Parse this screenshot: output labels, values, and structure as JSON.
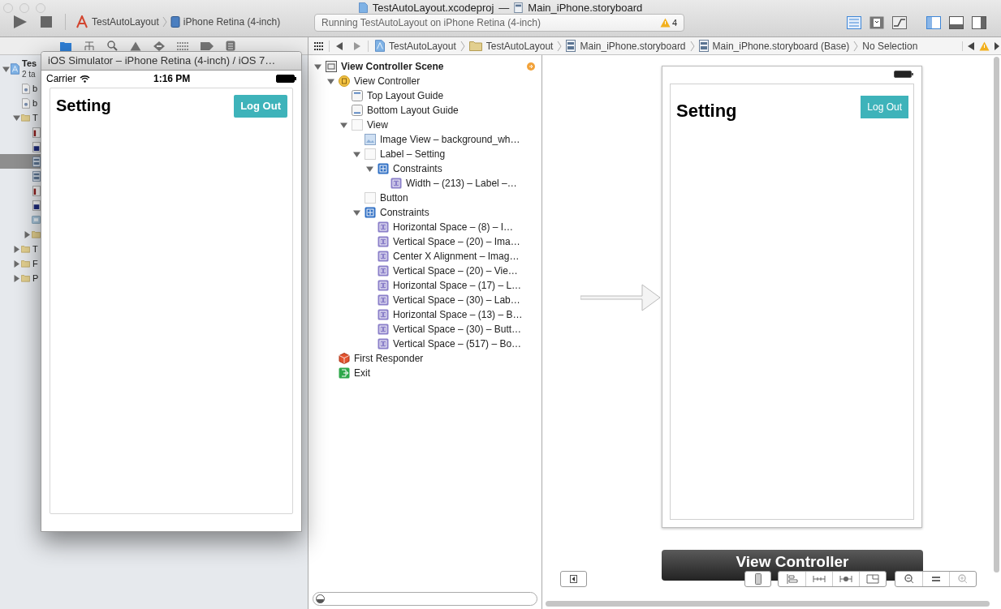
{
  "window": {
    "file": "TestAutoLayout.xcodeproj",
    "separator": "—",
    "document": "Main_iPhone.storyboard"
  },
  "toolbar": {
    "scheme": "TestAutoLayout",
    "destination": "iPhone Retina (4-inch)",
    "activity": "Running TestAutoLayout on iPhone Retina (4-inch)",
    "warning_count": "4"
  },
  "navigator": {
    "items": [
      {
        "text": "Tes",
        "subtitle": "2 ta",
        "kind": "project",
        "selected": false,
        "expanded": true,
        "children": [
          {
            "text": "b",
            "kind": "image-file",
            "selected": false
          },
          {
            "text": "b",
            "kind": "image-file",
            "selected": false
          },
          {
            "text": "T",
            "kind": "folder",
            "selected": false,
            "expanded": true,
            "children": [
              {
                "kind": "header",
                "selected": false
              },
              {
                "kind": "source",
                "selected": false
              },
              {
                "kind": "storyboard",
                "selected": true
              },
              {
                "kind": "storyboard",
                "selected": false
              },
              {
                "kind": "header",
                "selected": false
              },
              {
                "kind": "source",
                "selected": false
              },
              {
                "kind": "assets",
                "selected": false
              },
              {
                "kind": "folder",
                "selected": false,
                "expanded": false
              }
            ]
          },
          {
            "text": "T",
            "kind": "folder",
            "selected": false,
            "expanded": false
          },
          {
            "text": "F",
            "kind": "folder",
            "selected": false,
            "expanded": false
          },
          {
            "text": "P",
            "kind": "folder",
            "selected": false,
            "expanded": false
          }
        ]
      }
    ]
  },
  "simulator": {
    "title": "iOS Simulator – iPhone Retina (4-inch) / iOS 7…",
    "carrier": "Carrier",
    "time": "1:16 PM",
    "label": "Setting",
    "button": "Log Out"
  },
  "jump_bar": {
    "path": [
      {
        "text": "TestAutoLayout",
        "kind": "project"
      },
      {
        "text": "TestAutoLayout",
        "kind": "folder"
      },
      {
        "text": "Main_iPhone.storyboard",
        "kind": "storyboard"
      },
      {
        "text": "Main_iPhone.storyboard (Base)",
        "kind": "storyboard"
      },
      {
        "text": "No Selection",
        "kind": "none"
      }
    ]
  },
  "outline": {
    "items": [
      {
        "text": "View Controller Scene",
        "kind": "scene",
        "expanded": true,
        "children": [
          {
            "text": "View Controller",
            "kind": "controller",
            "expanded": true,
            "children": [
              {
                "text": "Top Layout Guide",
                "kind": "top-guide"
              },
              {
                "text": "Bottom Layout Guide",
                "kind": "bottom-guide"
              },
              {
                "text": "View",
                "kind": "view",
                "expanded": true,
                "children": [
                  {
                    "text": "Image View – background_wh…",
                    "kind": "image"
                  },
                  {
                    "text": "Label – Setting",
                    "kind": "view",
                    "expanded": true,
                    "children": [
                      {
                        "text": "Constraints",
                        "kind": "constraints",
                        "expanded": true,
                        "children": [
                          {
                            "text": "Width – (213) – Label –…",
                            "kind": "constraint"
                          }
                        ]
                      }
                    ]
                  },
                  {
                    "text": "Button",
                    "kind": "view"
                  },
                  {
                    "text": "Constraints",
                    "kind": "constraints",
                    "expanded": true,
                    "children": [
                      {
                        "text": "Horizontal Space – (8) – I…",
                        "kind": "constraint"
                      },
                      {
                        "text": "Vertical Space – (20) – Ima…",
                        "kind": "constraint"
                      },
                      {
                        "text": "Center X Alignment – Imag…",
                        "kind": "constraint"
                      },
                      {
                        "text": "Vertical Space – (20) – Vie…",
                        "kind": "constraint"
                      },
                      {
                        "text": "Horizontal Space – (17) – L…",
                        "kind": "constraint"
                      },
                      {
                        "text": "Vertical Space – (30) – Lab…",
                        "kind": "constraint"
                      },
                      {
                        "text": "Horizontal Space – (13) – B…",
                        "kind": "constraint"
                      },
                      {
                        "text": "Vertical Space – (30) – Butt…",
                        "kind": "constraint"
                      },
                      {
                        "text": "Vertical Space – (517) – Bo…",
                        "kind": "constraint"
                      }
                    ]
                  }
                ]
              }
            ]
          },
          {
            "text": "First Responder",
            "kind": "responder"
          },
          {
            "text": "Exit",
            "kind": "exit"
          }
        ]
      }
    ]
  },
  "canvas": {
    "label": "Setting",
    "button": "Log Out",
    "scene_title": "View Controller"
  }
}
